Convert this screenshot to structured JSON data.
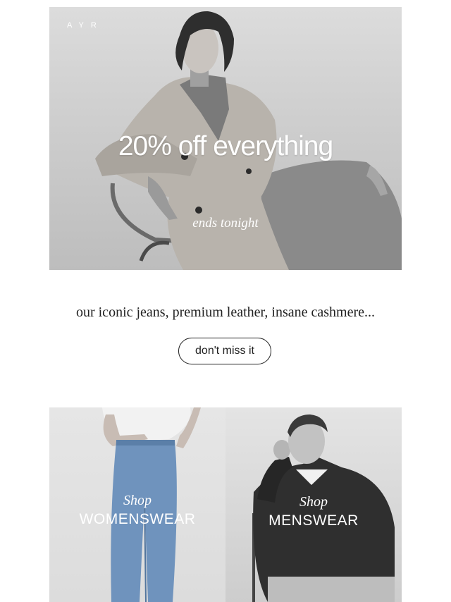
{
  "hero": {
    "logo": "AYR",
    "headline": "20% off everything",
    "subline": "ends tonight"
  },
  "promo": {
    "tagline": "our iconic jeans, premium leather, insane cashmere...",
    "cta_label": "don't miss it"
  },
  "tiles": [
    {
      "shop_label": "Shop",
      "category": "WOMENSWEAR"
    },
    {
      "shop_label": "Shop",
      "category": "MENSWEAR"
    }
  ]
}
